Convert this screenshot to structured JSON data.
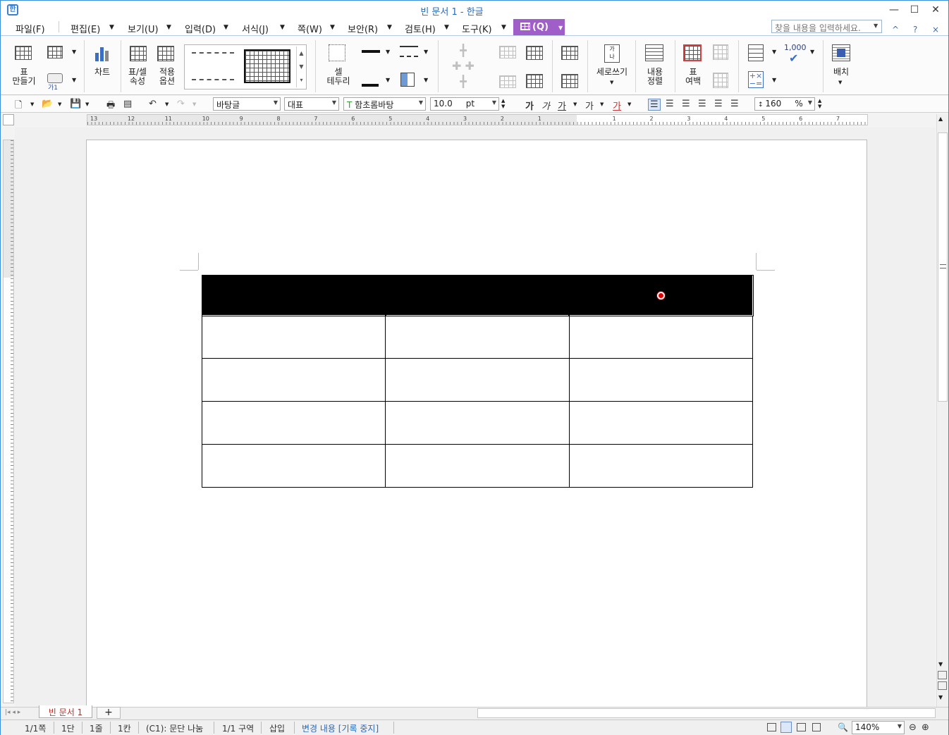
{
  "window": {
    "title": "빈 문서 1 - 한글",
    "app_icon": "한",
    "buttons": {
      "minimize": "—",
      "maximize": "☐",
      "close": "✕"
    }
  },
  "menu": {
    "items": [
      "파일(F)",
      "편집(E)",
      "보기(U)",
      "입력(D)",
      "서식(J)",
      "쪽(W)",
      "보안(R)",
      "검토(H)",
      "도구(K)"
    ],
    "table_tab": "(Q)",
    "search_placeholder": "찾을 내용을 입력하세요.",
    "right_controls": [
      "^",
      "?",
      "×"
    ]
  },
  "ribbon": {
    "table_make": "표\n만들기",
    "chart": "차트",
    "table_props": "표/셀\n속성",
    "apply_options": "적용\n옵션",
    "cell_border": "셀\n테두리",
    "vertical_writing": "세로쓰기",
    "content_align": "내용\n정렬",
    "table_margin": "표\n여백",
    "number_label": "1,000",
    "arrange": "배치",
    "small_label": "가1"
  },
  "toolbar": {
    "style": "바탕글",
    "language": "대표",
    "font": "함초롬바탕",
    "font_size": "10.0",
    "unit": "pt",
    "char_buttons": [
      "가",
      "가",
      "가",
      "가",
      "가"
    ],
    "line_spacing": "160",
    "line_spacing_unit": "%"
  },
  "ruler": {
    "labels": [
      "13",
      "12",
      "11",
      "10",
      "9",
      "8",
      "7",
      "6",
      "5",
      "4",
      "3",
      "2",
      "1",
      "",
      "1",
      "2",
      "3",
      "4",
      "5",
      "6",
      "7"
    ]
  },
  "document": {
    "rows": 5,
    "columns": 3,
    "header_fill": "#000000"
  },
  "tabs": {
    "doc_tab": "빈 문서 1",
    "add": "+"
  },
  "status": {
    "page": "1/1쪽",
    "column": "1단",
    "line": "1줄",
    "col_pos": "1칸",
    "cell_info": "(C1): 문단 나눔",
    "section": "1/1 구역",
    "insert_mode": "삽입",
    "change_tracking": "변경 내용 [기록 중지]",
    "zoom": "140%"
  },
  "colors": {
    "accent": "#a05ec8",
    "title": "#2a6ab8",
    "dot": "#e40000"
  }
}
